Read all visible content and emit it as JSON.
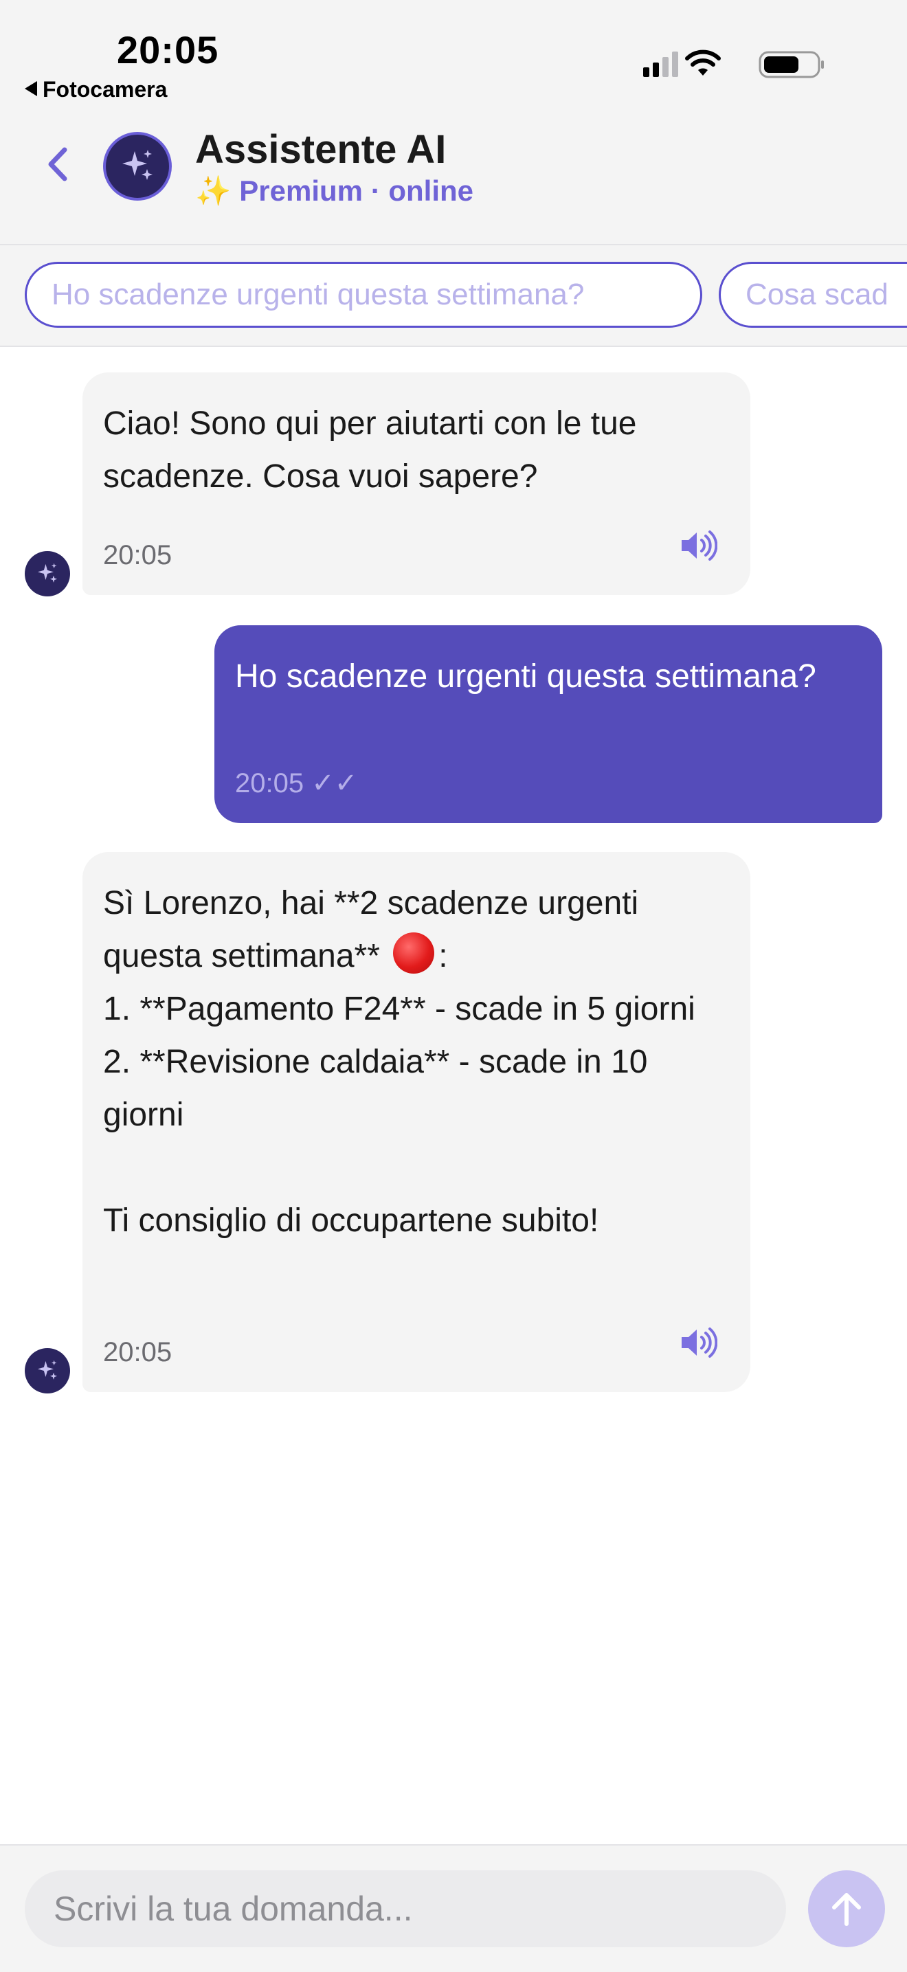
{
  "status_bar": {
    "time": "20:05",
    "back_app": "Fotocamera"
  },
  "header": {
    "title": "Assistente AI",
    "subtitle_emoji": "✨",
    "subtitle": "Premium · online"
  },
  "suggestions": [
    "Ho scadenze urgenti questa settimana?",
    "Cosa scad"
  ],
  "messages": [
    {
      "sender": "assistant",
      "text": "Ciao! Sono qui per aiutarti con le tue scadenze. Cosa vuoi sapere?",
      "time": "20:05"
    },
    {
      "sender": "user",
      "text": "Ho scadenze urgenti questa settimana?",
      "time": "20:05",
      "status": "✓✓"
    },
    {
      "sender": "assistant",
      "text_line1": "Sì Lorenzo, hai **2 scadenze urgenti questa settimana**",
      "text_line1_suffix": ":",
      "text_rest": "1. **Pagamento F24** - scade in 5 giorni\n2. **Revisione caldaia** - scade in 10 giorni\n\nTi consiglio di occupartene subito!",
      "time": "20:05"
    }
  ],
  "input": {
    "placeholder": "Scrivi la tua domanda..."
  },
  "colors": {
    "accent": "#554cba",
    "accent_light": "#6f63d6",
    "avatar_bg": "#2b2560",
    "send_disabled": "#c9c3f2"
  }
}
